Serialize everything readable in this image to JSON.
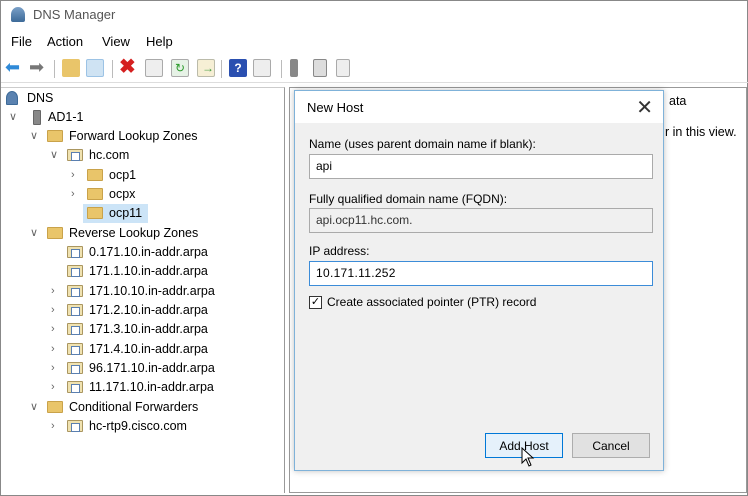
{
  "window": {
    "title": "DNS Manager"
  },
  "menu": [
    "File",
    "Action",
    "View",
    "Help"
  ],
  "toolbar": [
    {
      "icon": "back-arrow-icon"
    },
    {
      "icon": "forward-arrow-icon"
    },
    {
      "icon": "up-folder-icon"
    },
    {
      "icon": "show-hide-console-tree-icon"
    },
    {
      "icon": "delete-icon"
    },
    {
      "icon": "properties-icon"
    },
    {
      "icon": "refresh-icon"
    },
    {
      "icon": "export-list-icon"
    },
    {
      "icon": "help-icon"
    },
    {
      "icon": "show-action-pane-icon"
    },
    {
      "icon": "server-icon"
    },
    {
      "icon": "record-icon"
    },
    {
      "icon": "copy-icon"
    }
  ],
  "tree": {
    "root": "DNS",
    "server": "AD1-1",
    "forward": "Forward Lookup Zones",
    "hc": "hc.com",
    "subzones": [
      "ocp1",
      "ocpx",
      "ocp11"
    ],
    "reverse": "Reverse Lookup Zones",
    "reverse_zones": [
      "0.171.10.in-addr.arpa",
      "171.1.10.in-addr.arpa",
      "171.10.10.in-addr.arpa",
      "171.2.10.in-addr.arpa",
      "171.3.10.in-addr.arpa",
      "171.4.10.in-addr.arpa",
      "96.171.10.in-addr.arpa",
      "11.171.10.in-addr.arpa"
    ],
    "conditional": "Conditional Forwarders",
    "cond_items": [
      "hc-rtp9.cisco.com"
    ]
  },
  "right": {
    "line1": "ata",
    "line2": "r in this view."
  },
  "dialog": {
    "title": "New Host",
    "name_label": "Name (uses parent domain name if blank):",
    "name_value": "api",
    "fqdn_label": "Fully qualified domain name (FQDN):",
    "fqdn_value": "api.ocp11.hc.com.",
    "ip_label": "IP address:",
    "ip_value": "10.171.11.252",
    "ptr_label": "Create associated pointer (PTR) record",
    "ptr_checked": true,
    "add_label": "Add Host",
    "cancel_label": "Cancel"
  }
}
